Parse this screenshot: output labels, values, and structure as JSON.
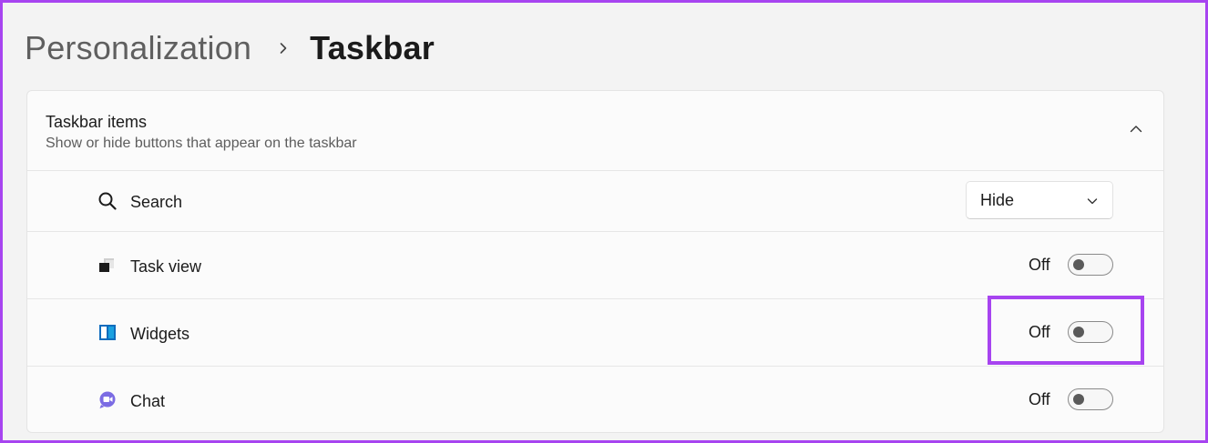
{
  "breadcrumb": {
    "parent": "Personalization",
    "separator_icon": "chevron-right-icon",
    "current": "Taskbar"
  },
  "section": {
    "title": "Taskbar items",
    "subtitle": "Show or hide buttons that appear on the taskbar",
    "expanded": true,
    "collapse_icon": "chevron-up-icon"
  },
  "items": [
    {
      "label": "Search",
      "icon": "search-icon",
      "control": "dropdown",
      "value": "Hide"
    },
    {
      "label": "Task view",
      "icon": "task-view-icon",
      "control": "toggle",
      "state": "Off"
    },
    {
      "label": "Widgets",
      "icon": "widgets-icon",
      "control": "toggle",
      "state": "Off"
    },
    {
      "label": "Chat",
      "icon": "chat-icon",
      "control": "toggle",
      "state": "Off"
    }
  ],
  "colors": {
    "highlight": "#a744f0",
    "widgets_icon": "#1aa0e0",
    "chat_icon": "#6b5ad6"
  }
}
